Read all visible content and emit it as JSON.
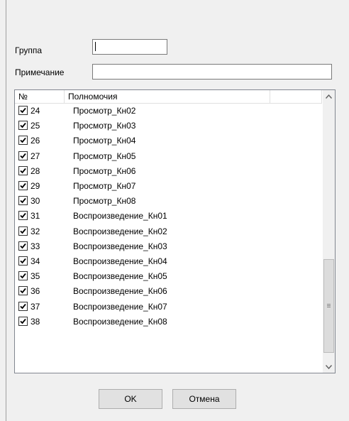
{
  "form": {
    "group_label": "Группа",
    "group_value": "",
    "note_label": "Примечание",
    "note_value": ""
  },
  "list": {
    "col_num": "№",
    "col_perm": "Полномочия",
    "rows": [
      {
        "num": "24",
        "perm": "Просмотр_Кн02",
        "checked": true
      },
      {
        "num": "25",
        "perm": "Просмотр_Кн03",
        "checked": true
      },
      {
        "num": "26",
        "perm": "Просмотр_Кн04",
        "checked": true
      },
      {
        "num": "27",
        "perm": "Просмотр_Кн05",
        "checked": true
      },
      {
        "num": "28",
        "perm": "Просмотр_Кн06",
        "checked": true
      },
      {
        "num": "29",
        "perm": "Просмотр_Кн07",
        "checked": true
      },
      {
        "num": "30",
        "perm": "Просмотр_Кн08",
        "checked": true
      },
      {
        "num": "31",
        "perm": "Воспроизведение_Кн01",
        "checked": true
      },
      {
        "num": "32",
        "perm": "Воспроизведение_Кн02",
        "checked": true
      },
      {
        "num": "33",
        "perm": "Воспроизведение_Кн03",
        "checked": true
      },
      {
        "num": "34",
        "perm": "Воспроизведение_Кн04",
        "checked": true
      },
      {
        "num": "35",
        "perm": "Воспроизведение_Кн05",
        "checked": true
      },
      {
        "num": "36",
        "perm": "Воспроизведение_Кн06",
        "checked": true
      },
      {
        "num": "37",
        "perm": "Воспроизведение_Кн07",
        "checked": true
      },
      {
        "num": "38",
        "perm": "Воспроизведение_Кн08",
        "checked": true
      }
    ]
  },
  "buttons": {
    "ok": "OK",
    "cancel": "Отмена"
  },
  "icons": {
    "checkbox": "checkmark-icon",
    "scroll_up": "scroll-up-arrow-icon",
    "scroll_down": "scroll-down-arrow-icon"
  }
}
